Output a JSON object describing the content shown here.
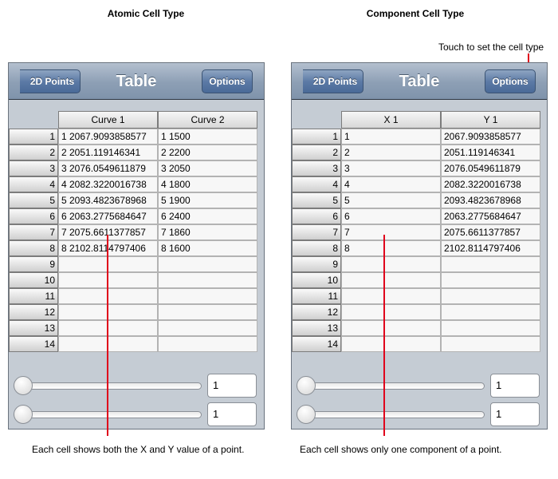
{
  "headings": {
    "left": "Atomic Cell Type",
    "right": "Component Cell Type"
  },
  "annotations": {
    "top_right": "Touch to set the cell type",
    "bottom_left": "Each cell shows both the X and Y value of a point.",
    "bottom_right": "Each cell shows only one component of a point."
  },
  "colors": {
    "annotation_line": "#e0001b",
    "nav_bar": "#8d9fb5",
    "panel_bg": "#c5ccd4"
  },
  "left_panel": {
    "nav": {
      "back_label": "2D Points",
      "title": "Table",
      "options_label": "Options"
    },
    "columns": [
      "Curve 1",
      "Curve 2"
    ],
    "row_labels": [
      "1",
      "2",
      "3",
      "4",
      "5",
      "6",
      "7",
      "8",
      "9",
      "10",
      "11",
      "12",
      "13",
      "14"
    ],
    "rows": [
      [
        "1 2067.9093858577",
        "1 1500"
      ],
      [
        "2 2051.119146341",
        "2 2200"
      ],
      [
        "3 2076.0549611879",
        "3 2050"
      ],
      [
        "4 2082.3220016738",
        "4 1800"
      ],
      [
        "5 2093.4823678968",
        "5 1900"
      ],
      [
        "6 2063.2775684647",
        "6 2400"
      ],
      [
        "7 2075.6611377857",
        "7 1860"
      ],
      [
        "8 2102.8114797406",
        "8 1600"
      ],
      [
        "",
        ""
      ],
      [
        "",
        ""
      ],
      [
        "",
        ""
      ],
      [
        "",
        ""
      ],
      [
        "",
        ""
      ],
      [
        "",
        ""
      ]
    ],
    "slider_fields": [
      "1",
      "1"
    ],
    "slider_values": [
      0,
      0
    ]
  },
  "right_panel": {
    "nav": {
      "back_label": "2D Points",
      "title": "Table",
      "options_label": "Options"
    },
    "columns": [
      "X 1",
      "Y 1"
    ],
    "row_labels": [
      "1",
      "2",
      "3",
      "4",
      "5",
      "6",
      "7",
      "8",
      "9",
      "10",
      "11",
      "12",
      "13",
      "14"
    ],
    "rows": [
      [
        "1",
        "2067.9093858577"
      ],
      [
        "2",
        "2051.119146341"
      ],
      [
        "3",
        "2076.0549611879"
      ],
      [
        "4",
        "2082.3220016738"
      ],
      [
        "5",
        "2093.4823678968"
      ],
      [
        "6",
        "2063.2775684647"
      ],
      [
        "7",
        "2075.6611377857"
      ],
      [
        "8",
        "2102.8114797406"
      ],
      [
        "",
        ""
      ],
      [
        "",
        ""
      ],
      [
        "",
        ""
      ],
      [
        "",
        ""
      ],
      [
        "",
        ""
      ],
      [
        "",
        ""
      ]
    ],
    "slider_fields": [
      "1",
      "1"
    ],
    "slider_values": [
      0,
      0
    ]
  }
}
